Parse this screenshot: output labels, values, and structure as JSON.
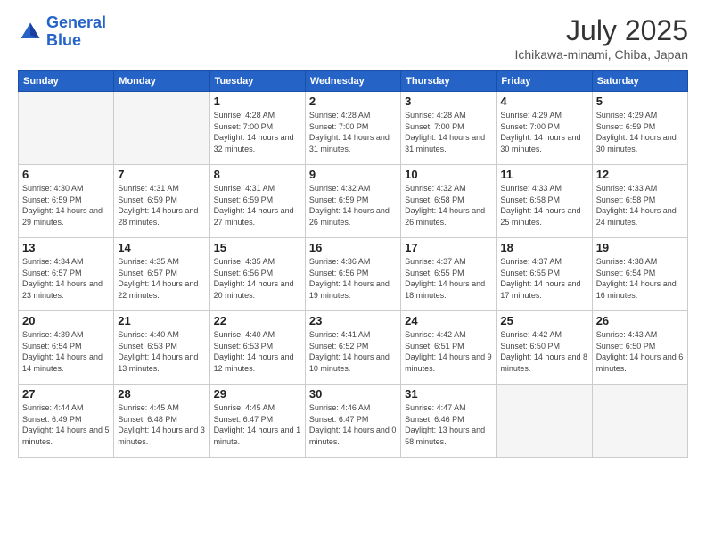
{
  "header": {
    "logo_line1": "General",
    "logo_line2": "Blue",
    "month": "July 2025",
    "location": "Ichikawa-minami, Chiba, Japan"
  },
  "weekdays": [
    "Sunday",
    "Monday",
    "Tuesday",
    "Wednesday",
    "Thursday",
    "Friday",
    "Saturday"
  ],
  "weeks": [
    [
      {
        "day": "",
        "empty": true
      },
      {
        "day": "",
        "empty": true
      },
      {
        "day": "1",
        "sunrise": "4:28 AM",
        "sunset": "7:00 PM",
        "daylight": "14 hours and 32 minutes."
      },
      {
        "day": "2",
        "sunrise": "4:28 AM",
        "sunset": "7:00 PM",
        "daylight": "14 hours and 31 minutes."
      },
      {
        "day": "3",
        "sunrise": "4:28 AM",
        "sunset": "7:00 PM",
        "daylight": "14 hours and 31 minutes."
      },
      {
        "day": "4",
        "sunrise": "4:29 AM",
        "sunset": "7:00 PM",
        "daylight": "14 hours and 30 minutes."
      },
      {
        "day": "5",
        "sunrise": "4:29 AM",
        "sunset": "6:59 PM",
        "daylight": "14 hours and 30 minutes."
      }
    ],
    [
      {
        "day": "6",
        "sunrise": "4:30 AM",
        "sunset": "6:59 PM",
        "daylight": "14 hours and 29 minutes."
      },
      {
        "day": "7",
        "sunrise": "4:31 AM",
        "sunset": "6:59 PM",
        "daylight": "14 hours and 28 minutes."
      },
      {
        "day": "8",
        "sunrise": "4:31 AM",
        "sunset": "6:59 PM",
        "daylight": "14 hours and 27 minutes."
      },
      {
        "day": "9",
        "sunrise": "4:32 AM",
        "sunset": "6:59 PM",
        "daylight": "14 hours and 26 minutes."
      },
      {
        "day": "10",
        "sunrise": "4:32 AM",
        "sunset": "6:58 PM",
        "daylight": "14 hours and 26 minutes."
      },
      {
        "day": "11",
        "sunrise": "4:33 AM",
        "sunset": "6:58 PM",
        "daylight": "14 hours and 25 minutes."
      },
      {
        "day": "12",
        "sunrise": "4:33 AM",
        "sunset": "6:58 PM",
        "daylight": "14 hours and 24 minutes."
      }
    ],
    [
      {
        "day": "13",
        "sunrise": "4:34 AM",
        "sunset": "6:57 PM",
        "daylight": "14 hours and 23 minutes."
      },
      {
        "day": "14",
        "sunrise": "4:35 AM",
        "sunset": "6:57 PM",
        "daylight": "14 hours and 22 minutes."
      },
      {
        "day": "15",
        "sunrise": "4:35 AM",
        "sunset": "6:56 PM",
        "daylight": "14 hours and 20 minutes."
      },
      {
        "day": "16",
        "sunrise": "4:36 AM",
        "sunset": "6:56 PM",
        "daylight": "14 hours and 19 minutes."
      },
      {
        "day": "17",
        "sunrise": "4:37 AM",
        "sunset": "6:55 PM",
        "daylight": "14 hours and 18 minutes."
      },
      {
        "day": "18",
        "sunrise": "4:37 AM",
        "sunset": "6:55 PM",
        "daylight": "14 hours and 17 minutes."
      },
      {
        "day": "19",
        "sunrise": "4:38 AM",
        "sunset": "6:54 PM",
        "daylight": "14 hours and 16 minutes."
      }
    ],
    [
      {
        "day": "20",
        "sunrise": "4:39 AM",
        "sunset": "6:54 PM",
        "daylight": "14 hours and 14 minutes."
      },
      {
        "day": "21",
        "sunrise": "4:40 AM",
        "sunset": "6:53 PM",
        "daylight": "14 hours and 13 minutes."
      },
      {
        "day": "22",
        "sunrise": "4:40 AM",
        "sunset": "6:53 PM",
        "daylight": "14 hours and 12 minutes."
      },
      {
        "day": "23",
        "sunrise": "4:41 AM",
        "sunset": "6:52 PM",
        "daylight": "14 hours and 10 minutes."
      },
      {
        "day": "24",
        "sunrise": "4:42 AM",
        "sunset": "6:51 PM",
        "daylight": "14 hours and 9 minutes."
      },
      {
        "day": "25",
        "sunrise": "4:42 AM",
        "sunset": "6:50 PM",
        "daylight": "14 hours and 8 minutes."
      },
      {
        "day": "26",
        "sunrise": "4:43 AM",
        "sunset": "6:50 PM",
        "daylight": "14 hours and 6 minutes."
      }
    ],
    [
      {
        "day": "27",
        "sunrise": "4:44 AM",
        "sunset": "6:49 PM",
        "daylight": "14 hours and 5 minutes."
      },
      {
        "day": "28",
        "sunrise": "4:45 AM",
        "sunset": "6:48 PM",
        "daylight": "14 hours and 3 minutes."
      },
      {
        "day": "29",
        "sunrise": "4:45 AM",
        "sunset": "6:47 PM",
        "daylight": "14 hours and 1 minute."
      },
      {
        "day": "30",
        "sunrise": "4:46 AM",
        "sunset": "6:47 PM",
        "daylight": "14 hours and 0 minutes."
      },
      {
        "day": "31",
        "sunrise": "4:47 AM",
        "sunset": "6:46 PM",
        "daylight": "13 hours and 58 minutes."
      },
      {
        "day": "",
        "empty": true
      },
      {
        "day": "",
        "empty": true
      }
    ]
  ]
}
